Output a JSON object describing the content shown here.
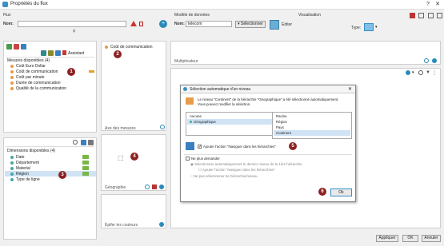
{
  "window": {
    "title": "Propriétés du flux",
    "help": "?",
    "close": "✕"
  },
  "flux": {
    "section": "Flux",
    "name_label": "Nom:",
    "name_value": ""
  },
  "model": {
    "section": "Modèle de données",
    "name_label": "Nom:",
    "name_value": "telecom",
    "select_label": "Sélectionner",
    "edit_label": "Éditer"
  },
  "viz": {
    "section": "Visualisation",
    "type_label": "Type:"
  },
  "measures": {
    "assist_label": "Assistant",
    "header": "Mesures disponibles (4)",
    "items": [
      "Coût Euro Dollar",
      "Coût de communication",
      "Coût par minute",
      "Durée de communication",
      "Qualité de la communication"
    ]
  },
  "dimensions": {
    "header": "Dimensions disponibles (4)",
    "items": [
      "Date",
      "Département",
      "Material",
      "Région",
      "Type de ligne"
    ]
  },
  "drop": {
    "measure_item": "Coût de communication",
    "measures_axis": "Axe des mesures",
    "geo": "Géographie",
    "colors": "Épifer les couleurs"
  },
  "multiplicateur": "Multiplicateur",
  "dialog": {
    "title": "Sélection automatique d'un niveau",
    "message1": "Le niveau \"Continent\" de la hiérarchie \"Géographique\" a été sélectionné automatiquement.",
    "message2": "Vous pouvez modifier la sélection.",
    "hier_items": [
      "Aucune",
      "Géographique"
    ],
    "level_items": [
      "Racine",
      "Région",
      "Pays",
      "Continent"
    ],
    "nav_check": "Ajouter l'action \"Naviguer dans les hiérarchies\"",
    "no_ask": "Ne plus demander",
    "opt1": "Sélectionner automatiquement le dernier niveau de la 1ère hiérarchie.",
    "opt1b": "Ajouter l'action \"Naviguer dans les hiérarchies\"",
    "opt2": "Ne pas sélectionner de hiérarchie/niveau.",
    "ok": "Ok"
  },
  "badges": [
    "1",
    "2",
    "3",
    "4",
    "5",
    "6"
  ],
  "footer": {
    "apply": "Appliquer",
    "ok": "OK",
    "cancel": "Annuler"
  },
  "colors": {
    "accent": "#3a8fc7",
    "badge": "#8b2222",
    "selection": "#cfe3f5"
  }
}
